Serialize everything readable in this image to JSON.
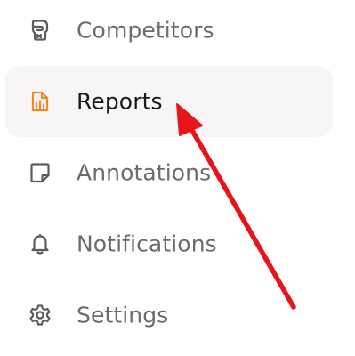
{
  "colors": {
    "active_background": "#f8f5f6",
    "active_icon": "#f08a2a",
    "inactive_icon": "#5f5a5e",
    "inactive_text": "#6f6a6d",
    "active_text": "#1b1b1f",
    "annotation_arrow": "#e8141b"
  },
  "nav": {
    "items": [
      {
        "label": "Competitors",
        "icon": "boxing-glove-icon",
        "active": false
      },
      {
        "label": "Reports",
        "icon": "report-document-icon",
        "active": true
      },
      {
        "label": "Annotations",
        "icon": "note-icon",
        "active": false
      },
      {
        "label": "Notifications",
        "icon": "bell-icon",
        "active": false
      },
      {
        "label": "Settings",
        "icon": "gear-icon",
        "active": false
      }
    ]
  },
  "annotation": {
    "type": "arrow",
    "points_to": "Reports"
  }
}
